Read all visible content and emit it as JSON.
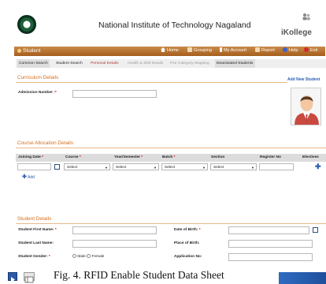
{
  "header": {
    "institute_name": "National Institute of Technology Nagaland",
    "brand": "iKollege",
    "logo_icon": "institute-seal-logo"
  },
  "nav": {
    "module": "Student",
    "items": [
      {
        "label": "Home",
        "icon": "home-icon"
      },
      {
        "label": "Grouping",
        "icon": "book-icon"
      },
      {
        "label": "My Account",
        "icon": "info-icon"
      },
      {
        "label": "Report",
        "icon": "book-icon"
      },
      {
        "label": "Help",
        "icon": "help-icon"
      },
      {
        "label": "Exit",
        "icon": "power-icon"
      }
    ],
    "bar_color": "#b2702f"
  },
  "subtabs": [
    {
      "label": "Common Search",
      "state": "active"
    },
    {
      "label": "Student Search",
      "state": "plain"
    },
    {
      "label": "Personal Details",
      "state": "current"
    },
    {
      "label": "Health & Skill Details",
      "state": "disabled"
    },
    {
      "label": "Fee Category Mapping",
      "state": "disabled"
    },
    {
      "label": "Deactivated Students",
      "state": "active"
    }
  ],
  "curriculum": {
    "title": "Curriculum Details",
    "add_new": "Add New Student",
    "admission_label": "Admission Number :",
    "req_mark": "*",
    "admission_value": ""
  },
  "course": {
    "title": "Course Allocation Details",
    "headers": [
      "Joining Date",
      "Course",
      "Year/Semester",
      "Batch",
      "Section",
      "Register No",
      "Electives"
    ],
    "select_value": "Select",
    "add_label": "Add"
  },
  "student": {
    "title": "Student Details",
    "first_name_label": "Student First Name: ",
    "last_name_label": "Student Last Name:",
    "gender_label": "Student Gender: ",
    "male_label": "Male",
    "female_label": "Female",
    "dob_label": "Date of Birth: ",
    "pob_label": "Place of Birth:",
    "app_no_label": "Application No:"
  },
  "caption": "Fig. 4. RFID Enable Student Data Sheet",
  "colors": {
    "section_title": "#d4701f",
    "link": "#2a5db0",
    "current_tab": "#b23a3a"
  }
}
